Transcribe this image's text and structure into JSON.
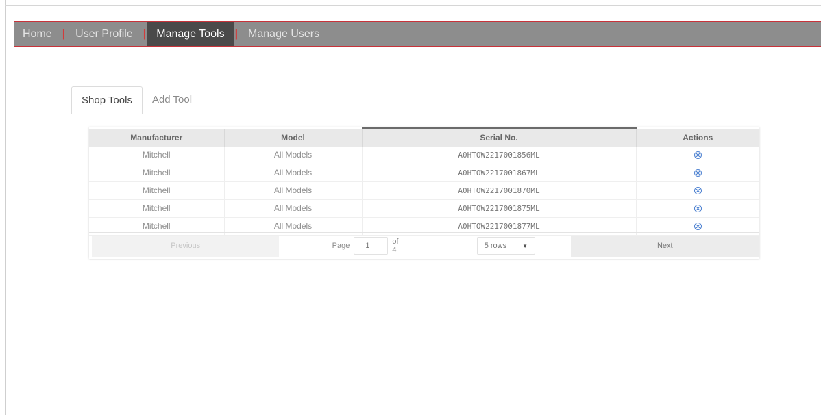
{
  "nav": {
    "items": [
      {
        "label": "Home"
      },
      {
        "label": "User Profile"
      },
      {
        "label": "Manage Tools"
      },
      {
        "label": "Manage Users"
      }
    ],
    "separator": "|",
    "active": "Manage Tools",
    "accent_color": "#c8333a"
  },
  "tabs": {
    "items": [
      {
        "label": "Shop Tools"
      },
      {
        "label": "Add Tool"
      }
    ],
    "active": "Shop Tools"
  },
  "table": {
    "columns": [
      "Manufacturer",
      "Model",
      "Serial No.",
      "Actions"
    ],
    "sorted_column": "Serial No.",
    "rows": [
      {
        "manufacturer": "Mitchell",
        "model": "All Models",
        "serial": "A0HTOW2217001856ML",
        "action_icon": "remove-icon"
      },
      {
        "manufacturer": "Mitchell",
        "model": "All Models",
        "serial": "A0HTOW2217001867ML",
        "action_icon": "remove-icon"
      },
      {
        "manufacturer": "Mitchell",
        "model": "All Models",
        "serial": "A0HTOW2217001870ML",
        "action_icon": "remove-icon"
      },
      {
        "manufacturer": "Mitchell",
        "model": "All Models",
        "serial": "A0HTOW2217001875ML",
        "action_icon": "remove-icon"
      },
      {
        "manufacturer": "Mitchell",
        "model": "All Models",
        "serial": "A0HTOW2217001877ML",
        "action_icon": "remove-icon"
      }
    ]
  },
  "pagination": {
    "previous_label": "Previous",
    "page_label": "Page",
    "current_page": "1",
    "of_label": "of 4",
    "rows_option": "5 rows",
    "next_label": "Next"
  }
}
